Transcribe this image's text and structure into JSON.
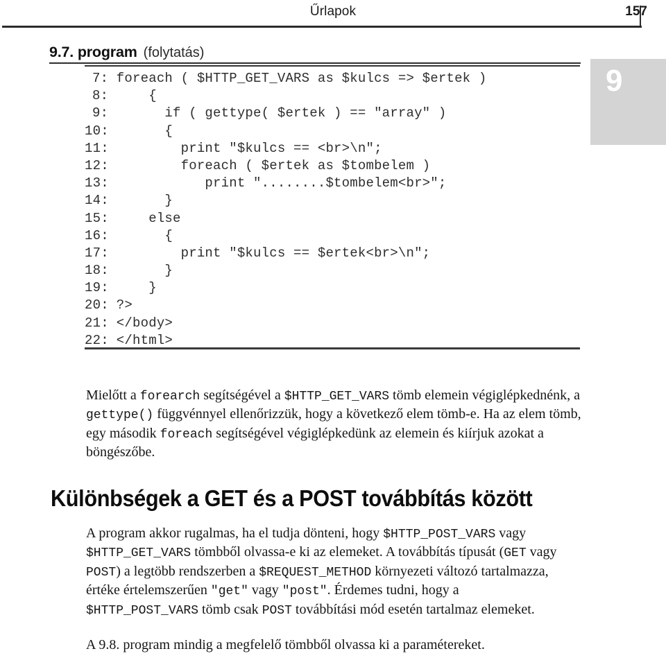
{
  "header": {
    "title": "Űrlapok",
    "page_number": "157"
  },
  "chapter_tab": {
    "number": "9"
  },
  "program_caption": {
    "number": "9.7. program",
    "continuation": "(folytatás)"
  },
  "code_listing": {
    "language": "php",
    "lines": [
      {
        "number": "7:",
        "text": " foreach ( $HTTP_GET_VARS as $kulcs => $ertek )"
      },
      {
        "number": "8:",
        "text": "     {"
      },
      {
        "number": "9:",
        "text": "       if ( gettype( $ertek ) == \"array\" )"
      },
      {
        "number": "10:",
        "text": "       {"
      },
      {
        "number": "11:",
        "text": "         print \"$kulcs == <br>\\n\";"
      },
      {
        "number": "12:",
        "text": "         foreach ( $ertek as $tombelem )"
      },
      {
        "number": "13:",
        "text": "            print \"........$tombelem<br>\";"
      },
      {
        "number": "14:",
        "text": "       }"
      },
      {
        "number": "15:",
        "text": "     else"
      },
      {
        "number": "16:",
        "text": "       {"
      },
      {
        "number": "17:",
        "text": "         print \"$kulcs == $ertek<br>\\n\";"
      },
      {
        "number": "18:",
        "text": "       }"
      },
      {
        "number": "19:",
        "text": "     }"
      },
      {
        "number": "20:",
        "text": " ?>"
      },
      {
        "number": "21:",
        "text": " </body>"
      },
      {
        "number": "22:",
        "text": " </html>"
      }
    ]
  },
  "paragraphs": {
    "intro_html": "Mielőtt a <span class=\"mono\">forearch</span> segítségével a <span class=\"mono\">$HTTP_GET_VARS</span> tömb elemein végiglépkednénk, a <span class=\"mono\">gettype()</span> függvénnyel ellenőrizzük, hogy a következő elem tömb-e. Ha az elem tömb, egy második <span class=\"mono\">foreach</span> segítségével végiglépkedünk az elemein és kiírjuk azokat a böngészőbe.",
    "get_post_1_html": "A program akkor rugalmas, ha el tudja dönteni, hogy <span class=\"mono\">$HTTP_POST_VARS</span> vagy <span class=\"mono\">$HTTP_GET_VARS</span> tömbből olvassa-e ki az elemeket. A továbbítás típusát (<span class=\"mono\">GET</span> vagy <span class=\"mono\">POST</span>) a legtöbb rendszerben a <span class=\"mono\">$REQUEST_METHOD</span> környezeti változó tartalmazza, értéke értelemszerűen <span class=\"mono\">\"get\"</span> vagy <span class=\"mono\">\"post\"</span>. Érdemes tudni, hogy a <span class=\"mono\">$HTTP_POST_VARS</span> tömb csak <span class=\"mono\">POST</span> továbbítási mód esetén tartalmaz elemeket.",
    "final_html": "A 9.8. program mindig a megfelelő tömbből olvassa ki a paramétereket."
  },
  "section_heading": {
    "text": "Különbségek a GET és a POST továbbítás között"
  },
  "colors": {
    "page_background": "#ffffff",
    "text": "#161616",
    "rule": "#2d2d2d",
    "chapter_tab_background": "#d4d4d4",
    "chapter_tab_number": "#ffffff",
    "code_text": "#2e2e2e"
  }
}
